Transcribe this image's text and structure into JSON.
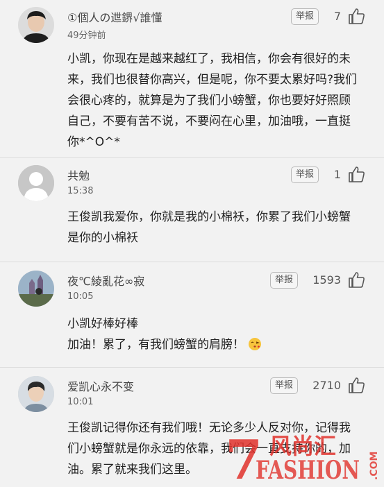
{
  "comments": [
    {
      "username": "①個人の迣鎅√誰懂",
      "time": "49分钟前",
      "report_label": "举报",
      "likes": "7",
      "text": "小凯，你现在是越来越红了，我相信，你会有很好的未来，我们也很替你高兴，但是呢，你不要太累好吗?我们会很心疼的，就算是为了我们小螃蟹，你也要好好照顾自己，不要有苦不说，不要闷在心里，加油哦，一直挺你*^O^*"
    },
    {
      "username": "共勉",
      "time": "15:38",
      "report_label": "举报",
      "likes": "1",
      "text": "王俊凯我爱你，你就是我的小棉袄，你累了我们小螃蟹是你的小棉袄"
    },
    {
      "username": "夜℃綾亂花∞寂",
      "time": "10:05",
      "report_label": "举报",
      "likes": "1593",
      "text_line1": "小凯好棒好棒",
      "text_line2": "加油！累了，有我们螃蟹的肩膀！"
    },
    {
      "username": "爱凯心永不变",
      "time": "10:01",
      "report_label": "举报",
      "likes": "2710",
      "text": "王俊凯记得你还有我们哦！无论多少人反对你，记得我们小螃蟹就是你永远的依靠，我们会一直支持你的，加油。累了就来我们这里。"
    }
  ],
  "watermark": {
    "number": "7",
    "chinese": "风尚汇",
    "latin": "FASHION",
    "suffix": ".COM"
  },
  "colors": {
    "background": "#f2f2f2",
    "divider": "#dcdcdc",
    "watermark_red": "#e0312b"
  },
  "icons": [
    "thumb-up-icon",
    "kiss-emoji-icon",
    "default-avatar-icon"
  ]
}
